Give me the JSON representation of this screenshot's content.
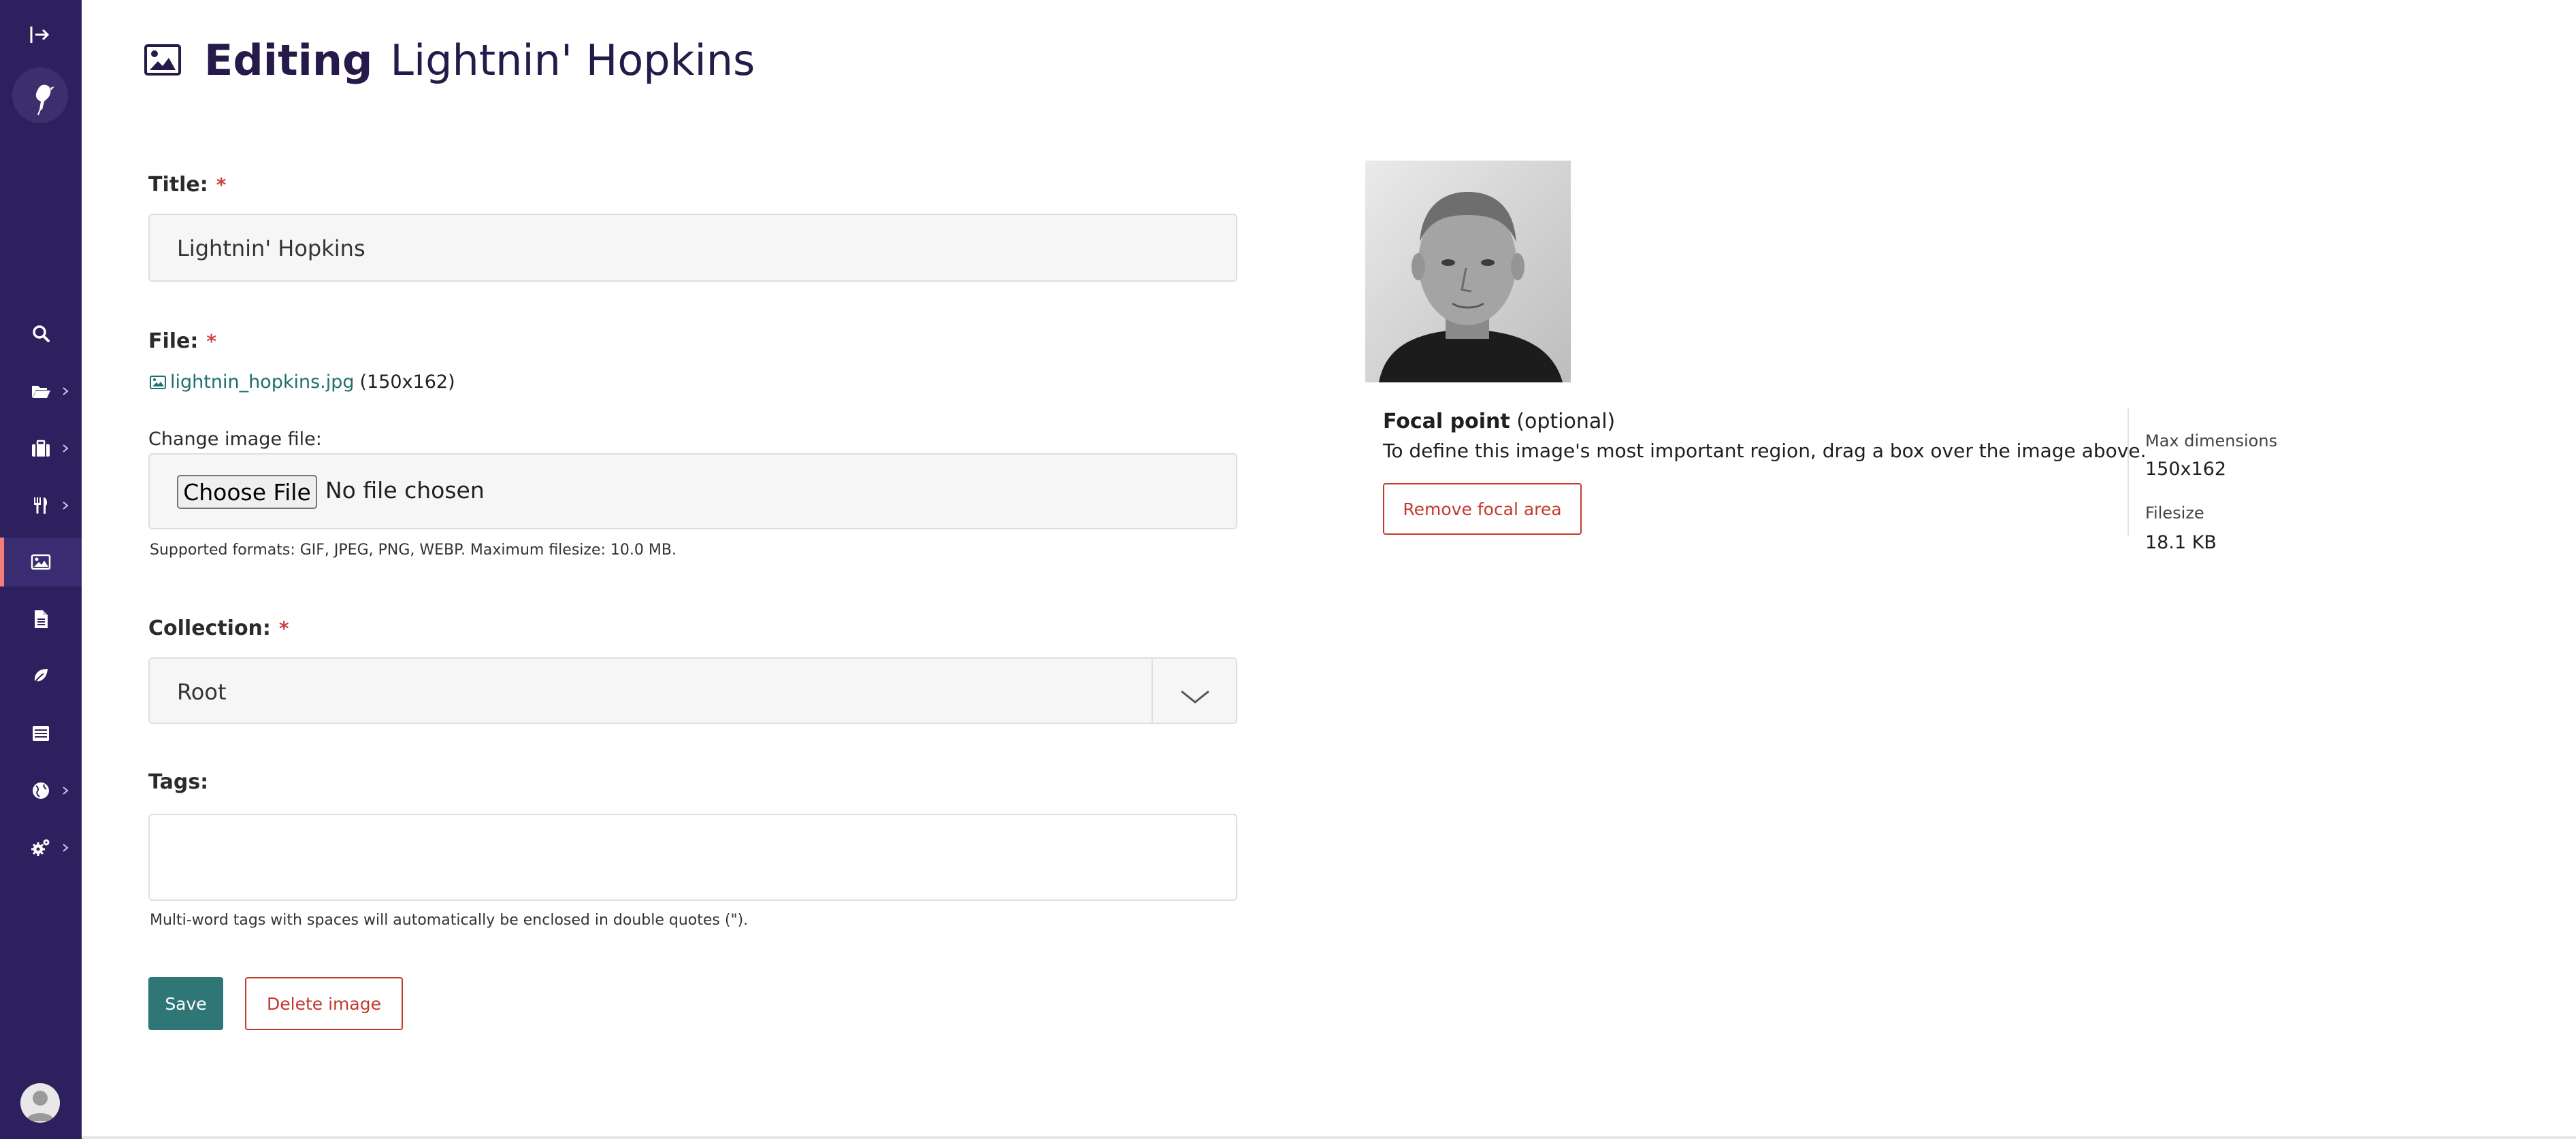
{
  "header": {
    "editing_label": "Editing",
    "image_name": "Lightnin' Hopkins"
  },
  "form": {
    "title": {
      "label": "Title:",
      "required_mark": "*",
      "value": "Lightnin' Hopkins"
    },
    "file": {
      "label": "File:",
      "required_mark": "*",
      "filename": "lightnin_hopkins.jpg",
      "dimensions": "(150x162)",
      "change_label": "Change image file:",
      "choose_button": "Choose File",
      "no_file_text": "No file chosen",
      "help": "Supported formats: GIF, JPEG, PNG, WEBP. Maximum filesize: 10.0 MB."
    },
    "collection": {
      "label": "Collection:",
      "required_mark": "*",
      "selected": "Root"
    },
    "tags": {
      "label": "Tags:",
      "value": "",
      "help": "Multi-word tags with spaces will automatically be enclosed in double quotes (\")."
    },
    "save_button": "Save",
    "delete_button": "Delete image"
  },
  "focal": {
    "title": "Focal point",
    "optional": "(optional)",
    "description": "To define this image's most important region, drag a box over the image above.",
    "remove_button": "Remove focal area"
  },
  "meta": {
    "max_dimensions_label": "Max dimensions",
    "max_dimensions_value": "150x162",
    "filesize_label": "Filesize",
    "filesize_value": "18.1 KB"
  },
  "sidebar": {
    "items": [
      {
        "icon": "search-icon",
        "has_submenu": false
      },
      {
        "icon": "folder-open-icon",
        "has_submenu": true
      },
      {
        "icon": "briefcase-icon",
        "has_submenu": true
      },
      {
        "icon": "utensils-icon",
        "has_submenu": true
      },
      {
        "icon": "image-icon",
        "has_submenu": false,
        "active": true
      },
      {
        "icon": "document-icon",
        "has_submenu": false
      },
      {
        "icon": "leaf-icon",
        "has_submenu": false
      },
      {
        "icon": "snippets-icon",
        "has_submenu": false
      },
      {
        "icon": "globe-icon",
        "has_submenu": true
      },
      {
        "icon": "cogs-icon",
        "has_submenu": true
      }
    ]
  },
  "colors": {
    "sidebar_bg": "#2e1f5e",
    "accent_active": "#f37e77",
    "primary_button": "#2f7777",
    "danger": "#c33a2c",
    "link": "#1e6f6f"
  }
}
